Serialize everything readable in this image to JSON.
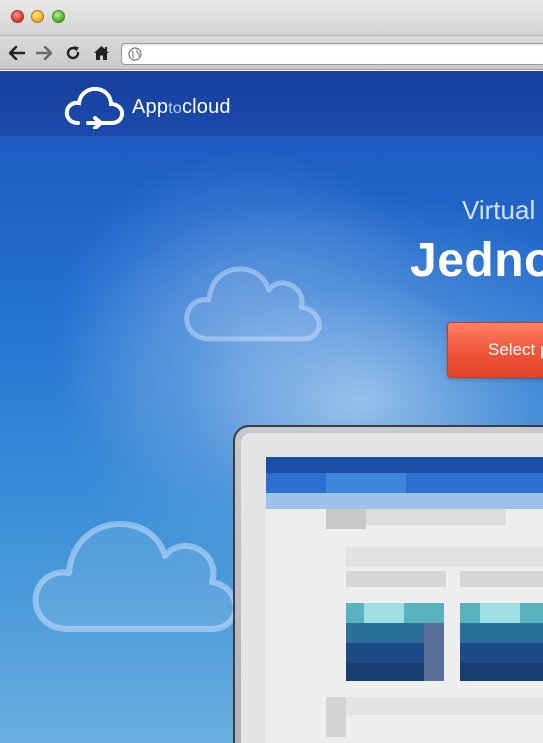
{
  "browser": {
    "address_value": "",
    "icons": {
      "back": "back-arrow-icon",
      "forward": "forward-arrow-icon",
      "reload": "reload-icon",
      "home": "home-icon",
      "globe": "globe-icon"
    }
  },
  "site": {
    "brand_prefix": "App",
    "brand_middle": "to",
    "brand_suffix": "cloud",
    "subtitle": "Virtual",
    "headline": "Jedno",
    "cta_label": "Select p"
  },
  "colors": {
    "header": "#1b4aac",
    "accent_button": "#f0553a",
    "page_gradient_top": "#1b53bd",
    "page_gradient_bottom": "#6aaee0"
  }
}
